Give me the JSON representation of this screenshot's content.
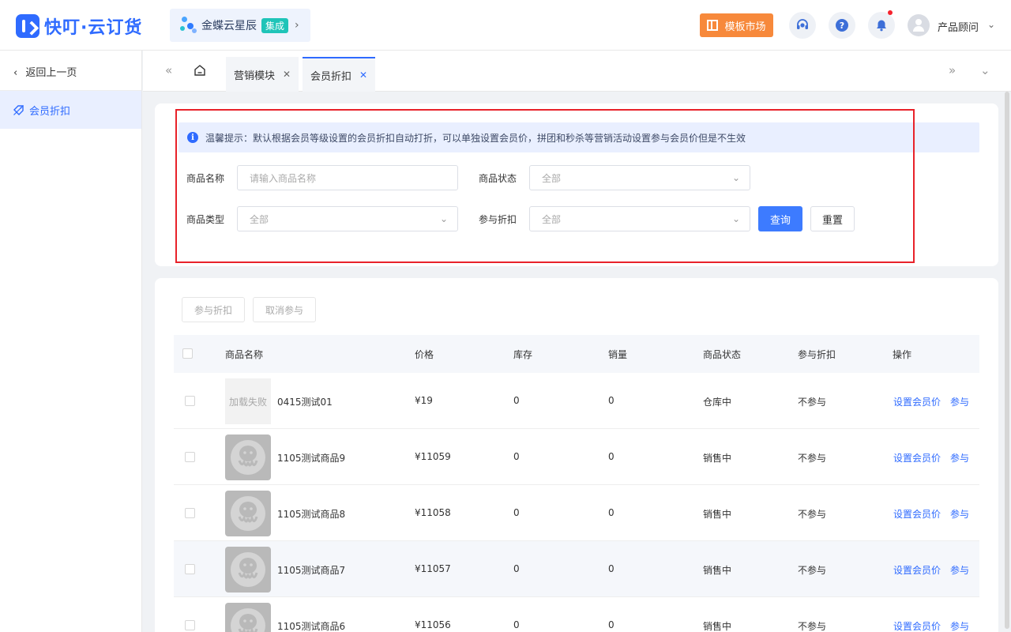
{
  "app": {
    "logo_text": "快叮·云订货",
    "kingdee": {
      "name": "金蝶云星辰",
      "tag": "集成"
    },
    "market_button": "模板市场",
    "user_name": "产品顾问"
  },
  "sidebar": {
    "back_label": "返回上一页",
    "items": [
      {
        "label": "会员折扣",
        "active": true
      }
    ]
  },
  "tabs": [
    {
      "label": "营销模块",
      "active": false
    },
    {
      "label": "会员折扣",
      "active": true
    }
  ],
  "notice": "温馨提示：默认根据会员等级设置的会员折扣自动打折，可以单独设置会员价，拼团和秒杀等营销活动设置参与会员价但是不生效",
  "filters": {
    "product_name": {
      "label": "商品名称",
      "placeholder": "请输入商品名称"
    },
    "product_status": {
      "label": "商品状态",
      "value": "全部"
    },
    "product_type": {
      "label": "商品类型",
      "value": "全部"
    },
    "discount": {
      "label": "参与折扣",
      "value": "全部"
    },
    "query_button": "查询",
    "reset_button": "重置"
  },
  "bulk_actions": {
    "join": "参与折扣",
    "cancel": "取消参与"
  },
  "table": {
    "headers": [
      "商品名称",
      "价格",
      "库存",
      "销量",
      "商品状态",
      "参与折扣",
      "操作"
    ],
    "rows": [
      {
        "image": "加载失败",
        "name": "0415测试01",
        "price": "¥19",
        "stock": "0",
        "sales": "0",
        "status": "仓库中",
        "discount": "不参与",
        "action_set": "设置会员价",
        "action_join": "参与"
      },
      {
        "image": "",
        "name": "1105测试商品9",
        "price": "¥11059",
        "stock": "0",
        "sales": "0",
        "status": "销售中",
        "discount": "不参与",
        "action_set": "设置会员价",
        "action_join": "参与"
      },
      {
        "image": "",
        "name": "1105测试商品8",
        "price": "¥11058",
        "stock": "0",
        "sales": "0",
        "status": "销售中",
        "discount": "不参与",
        "action_set": "设置会员价",
        "action_join": "参与"
      },
      {
        "image": "",
        "name": "1105测试商品7",
        "price": "¥11057",
        "stock": "0",
        "sales": "0",
        "status": "销售中",
        "discount": "不参与",
        "action_set": "设置会员价",
        "action_join": "参与"
      },
      {
        "image": "",
        "name": "1105测试商品6",
        "price": "¥11056",
        "stock": "0",
        "sales": "0",
        "status": "销售中",
        "discount": "不参与",
        "action_set": "设置会员价",
        "action_join": "参与"
      }
    ]
  },
  "colors": {
    "primary": "#2f6bff",
    "market": "#f7893b",
    "tag": "#1fc4b8",
    "highlight_frame": "#e8222a"
  }
}
